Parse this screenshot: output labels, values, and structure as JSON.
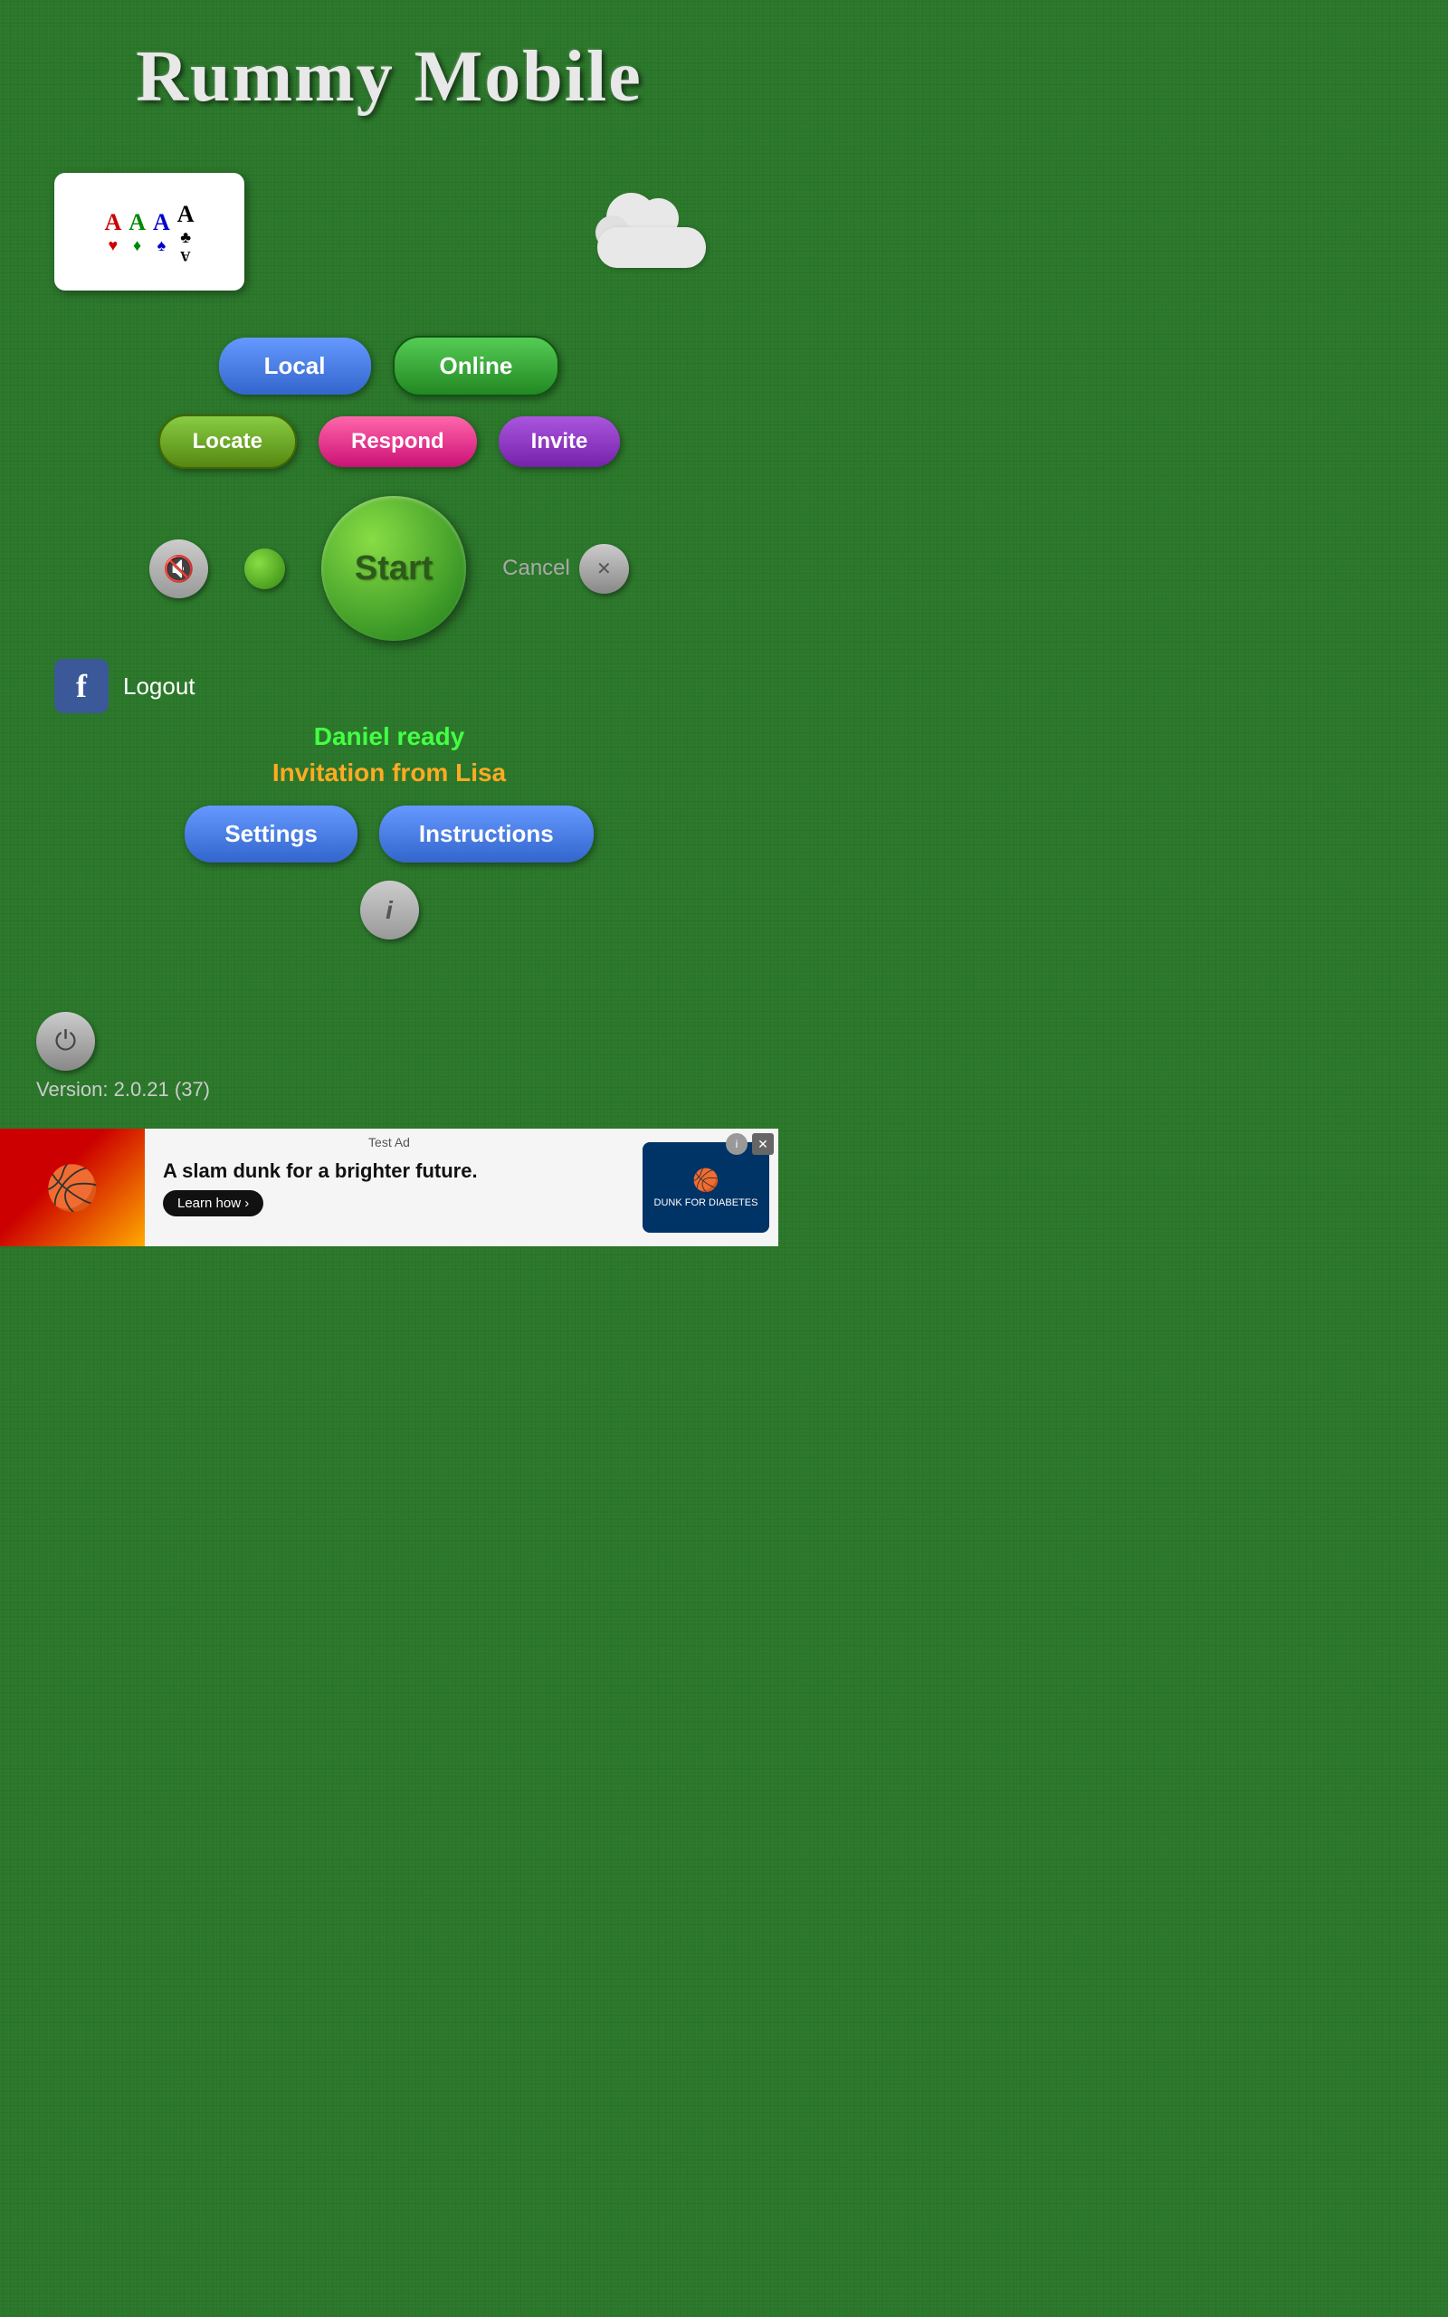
{
  "title": "Rummy Mobile",
  "cards": [
    {
      "letter": "A",
      "suit": "♥",
      "color": "red"
    },
    {
      "letter": "A",
      "suit": "♦",
      "color": "green-c"
    },
    {
      "letter": "A",
      "suit": "♠",
      "color": "blue"
    },
    {
      "letter": "A",
      "suit": "♣",
      "color": "black"
    }
  ],
  "buttons": {
    "local": "Local",
    "online": "Online",
    "locate": "Locate",
    "respond": "Respond",
    "invite": "Invite",
    "start": "Start",
    "cancel": "Cancel",
    "logout": "Logout",
    "settings": "Settings",
    "instructions": "Instructions"
  },
  "status": {
    "daniel_ready": "Daniel ready",
    "invitation": "Invitation from Lisa"
  },
  "version": "Version: 2.0.21 (37)",
  "ad": {
    "test_label": "Test Ad",
    "main_text": "A slam dunk for a brighter future.",
    "learn_more": "Learn how ›",
    "logo_text": "DUNK FOR\nDIABETES"
  }
}
